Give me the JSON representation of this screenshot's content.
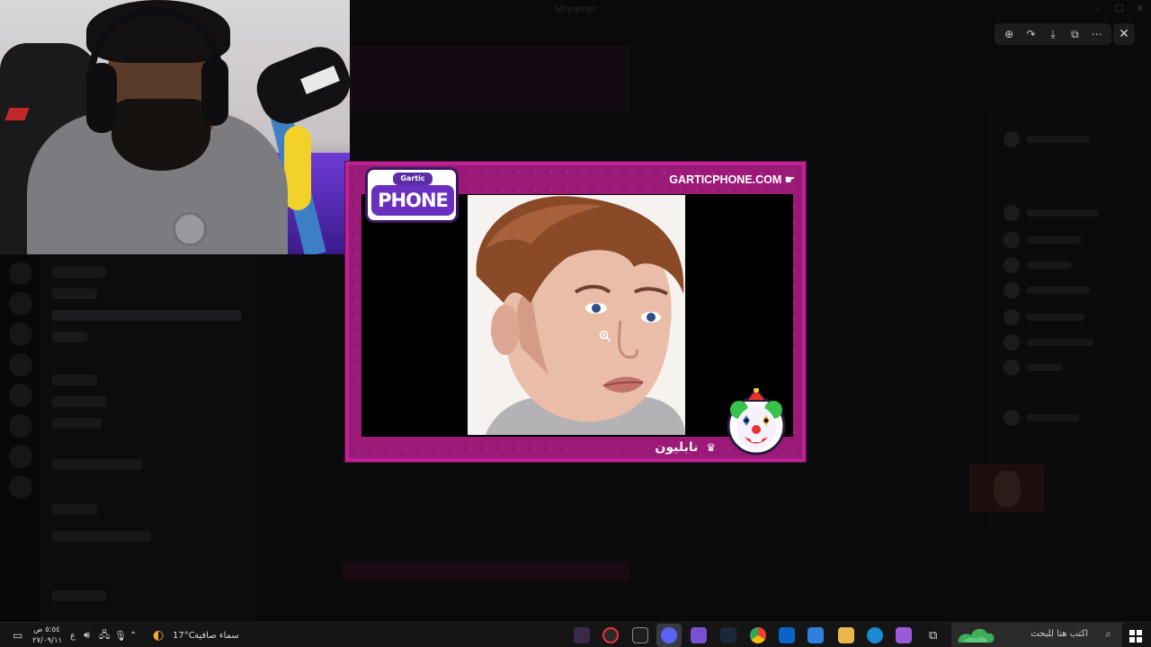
{
  "window": {
    "title": "Streamer",
    "controls": {
      "minimize": "–",
      "maximize": "☐",
      "close": "✕"
    }
  },
  "viewer_toolbar": {
    "icons": [
      "zoom-icon",
      "share-icon",
      "download-icon",
      "open-external-icon",
      "more-icon"
    ],
    "glyphs": [
      "⊕",
      "↷",
      "⤓",
      "⧉",
      "⋯"
    ],
    "close": "✕"
  },
  "gartic": {
    "logo_top": "Gartic",
    "logo_main": "PHONE",
    "url": "GARTICPHONE.COM",
    "url_icon": "☛",
    "author": "نابليون",
    "crown": "♛",
    "colors": {
      "frame": "#9b1a78",
      "border": "#bd2392",
      "logo": "#6b2fc0"
    }
  },
  "taskbar": {
    "search_placeholder": "اكتب هنا للبحث",
    "weather_temp": "17°C",
    "weather_desc": "سماء صافية",
    "lang": "ع",
    "clock_time": "٥:٥٤ ص",
    "clock_date": "٢٧/٠٩/١١",
    "tray_up": "⌃",
    "apps": [
      "explorer",
      "edge",
      "chrome",
      "steam",
      "store",
      "outlook",
      "copilot",
      "discord",
      "xbox",
      "obs",
      "gartic"
    ]
  }
}
